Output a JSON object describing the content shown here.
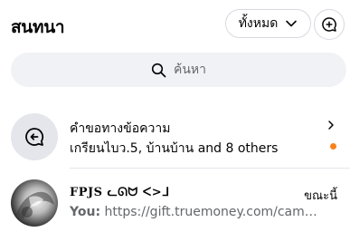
{
  "header": {
    "title": "สนทนา",
    "filter_label": "ทั้งหมด",
    "filter_icon": "chevron-down-icon",
    "compose_icon": "new-message-icon"
  },
  "search": {
    "placeholder": "ค้นหา",
    "icon": "search-icon"
  },
  "conversations": [
    {
      "title": "คำขอทางข้อความ",
      "preview": "เกรียนไบว.5, บ้านบ้าน and 8 others",
      "icon": "message-request-icon",
      "unread": true
    },
    {
      "name": "FPJS ᓚᘏᗢ ᐸ>ᒧ",
      "you_prefix": "You:",
      "preview": "https://gift.truemoney.com/campaign/...",
      "time": "ขณะนี้"
    }
  ],
  "colors": {
    "unread_dot": "#f7821b",
    "secondary_text": "#65676b",
    "search_bg": "#f0f2f5"
  }
}
